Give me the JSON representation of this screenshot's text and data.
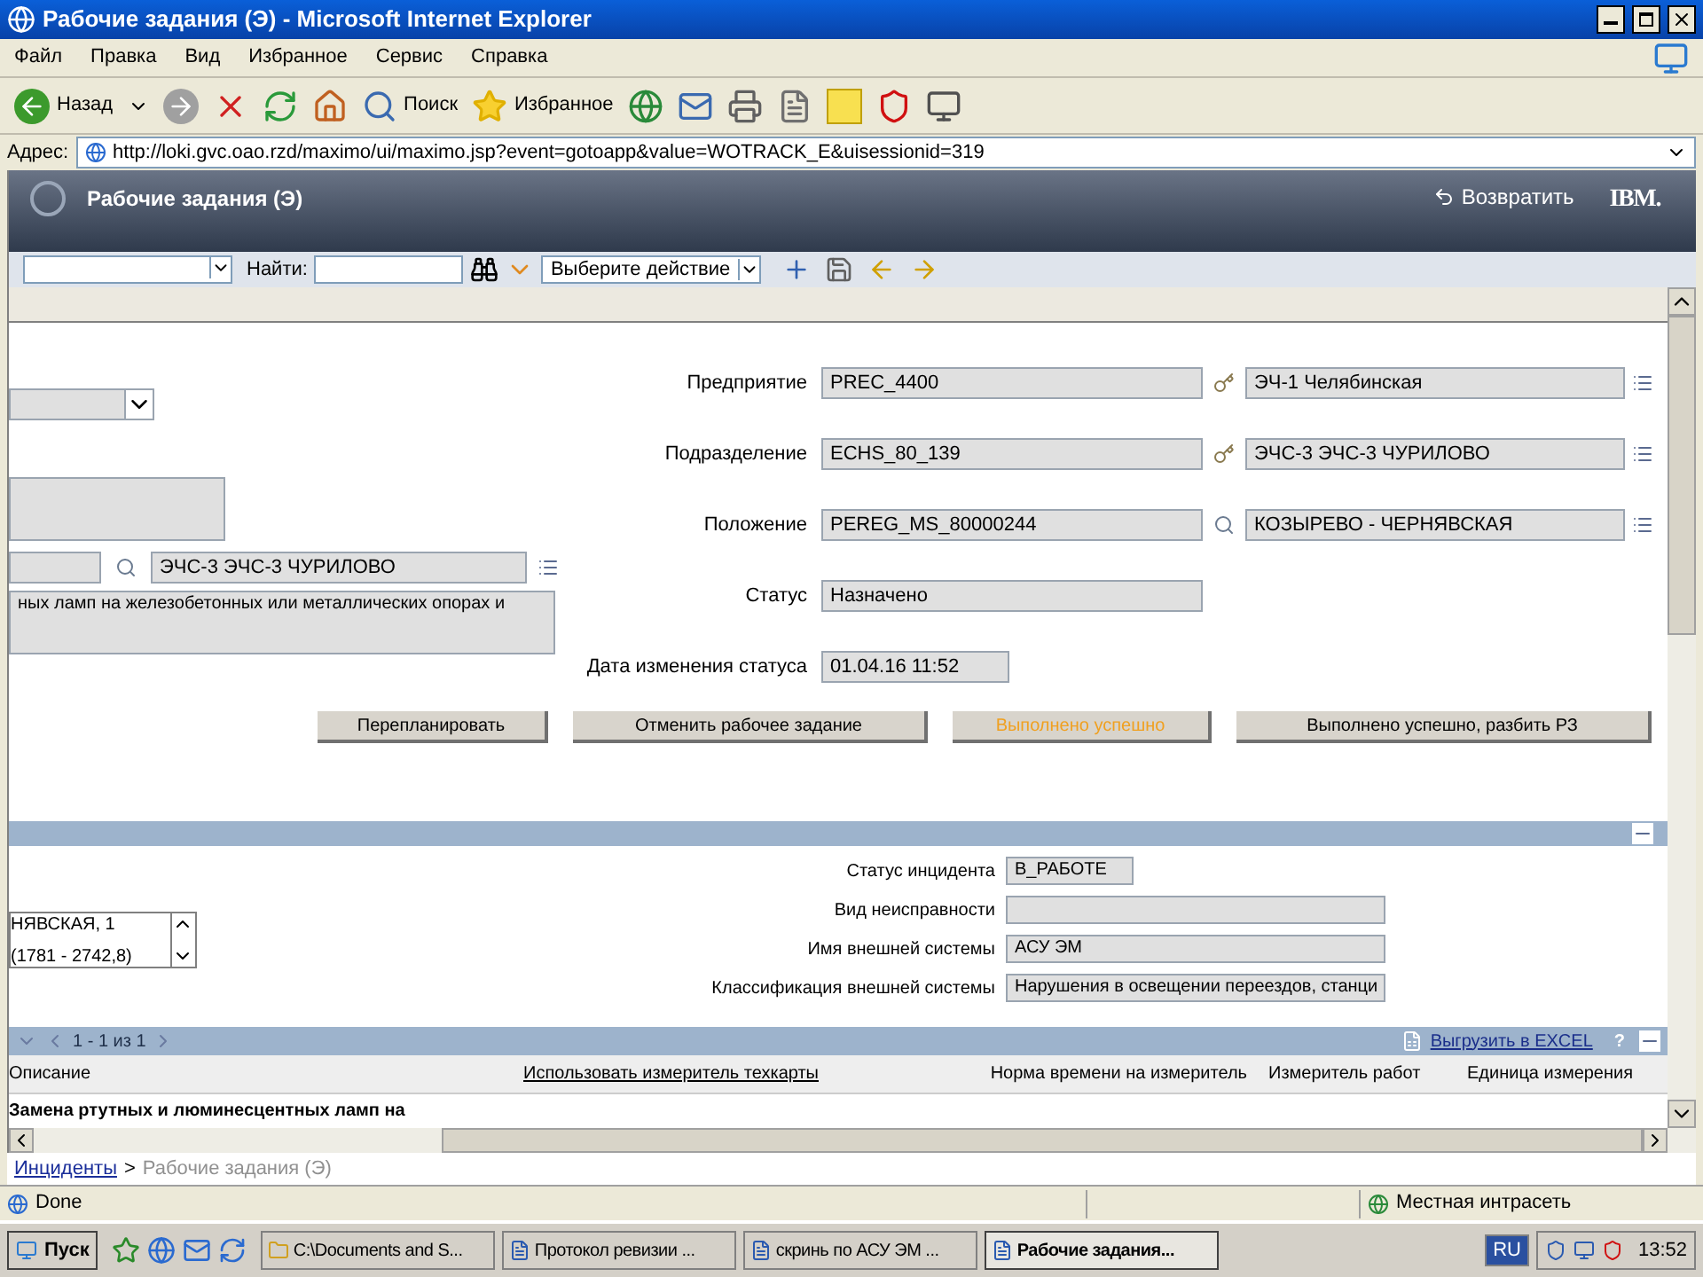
{
  "window": {
    "title": "Рабочие задания (Э) - Microsoft Internet Explorer"
  },
  "menu": [
    "Файл",
    "Правка",
    "Вид",
    "Избранное",
    "Сервис",
    "Справка"
  ],
  "toolbar": {
    "back": "Назад",
    "search": "Поиск",
    "favorites": "Избранное"
  },
  "address": {
    "label": "Адрес:",
    "url": "http://loki.gvc.oao.rzd/maximo/ui/maximo.jsp?event=gotoapp&value=WOTRACK_E&uisessionid=319"
  },
  "app": {
    "title": "Рабочие задания (Э)",
    "back_link": "Возвратить",
    "logo": "IBM."
  },
  "app_toolbar": {
    "find_label": "Найти:",
    "action_select": "Выберите действие"
  },
  "form_left": {
    "lookup_value": "ЭЧС-3 ЭЧС-3 ЧУРИЛОВО",
    "description": "ных ламп на железобетонных или металлических опорах и"
  },
  "form_right": [
    {
      "label": "Предприятие",
      "value": "PREC_4400",
      "kind": "lookup",
      "description": "ЭЧ-1 Челябинская"
    },
    {
      "label": "Подразделение",
      "value": "ECHS_80_139",
      "kind": "lookup",
      "description": "ЭЧС-3 ЭЧС-3 ЧУРИЛОВО"
    },
    {
      "label": "Положение",
      "value": "PEREG_MS_80000244",
      "kind": "lookup",
      "description": "КОЗЫРЕВО - ЧЕРНЯВСКАЯ"
    },
    {
      "label": "Статус",
      "value": "Назначено",
      "kind": "wide"
    },
    {
      "label": "Дата изменения статуса",
      "value": "01.04.16 11:52",
      "kind": "short"
    }
  ],
  "buttons": [
    {
      "label": "Перепланировать",
      "highlighted": false
    },
    {
      "label": "Отменить рабочее задание",
      "highlighted": false
    },
    {
      "label": "Выполнено успешно",
      "highlighted": true
    },
    {
      "label": "Выполнено успешно, разбить РЗ",
      "highlighted": false
    }
  ],
  "incident": {
    "list_lines": [
      "НЯВСКАЯ, 1",
      "(1781 - 2742,8)"
    ],
    "fields": [
      {
        "label": "Статус инцидента",
        "value": "В_РАБОТЕ",
        "kind": "short"
      },
      {
        "label": "Вид неисправности",
        "kind": "wide"
      },
      {
        "label": "Имя внешней системы",
        "value": "АСУ ЭМ",
        "kind": "wide"
      },
      {
        "label": "Классификация внешней системы",
        "value": "Нарушения в освещении переездов, станци",
        "kind": "wide"
      }
    ]
  },
  "table": {
    "pager": "1 - 1 из 1",
    "export": "Выгрузить в EXCEL",
    "help": "?",
    "columns": [
      {
        "label": "Описание",
        "link": false
      },
      {
        "label": "Использовать измеритель техкарты",
        "link": true
      },
      {
        "label": "Норма времени на измеритель",
        "link": false
      },
      {
        "label": "Измеритель работ",
        "link": false
      },
      {
        "label": "Единица измерения",
        "link": false
      }
    ],
    "rows": [
      {
        "description": "Замена ртутных и люминесцентных ламп на"
      }
    ]
  },
  "breadcrumb": [
    {
      "label": "Инциденты",
      "link": true
    },
    {
      "label": "Рабочие задания (Э)",
      "link": false
    }
  ],
  "breadcrumb_separator": ">",
  "status_bar": {
    "text": "Done",
    "zone": "Местная интрасеть"
  },
  "taskbar": {
    "start": "Пуск",
    "tasks": [
      {
        "label": "C:\\Documents and S...",
        "selected": false
      },
      {
        "label": "Протокол ревизии ...",
        "selected": false
      },
      {
        "label": "скринь по АСУ ЭМ ...",
        "selected": false
      },
      {
        "label": "Рабочие задания...",
        "selected": true
      }
    ],
    "lang": "RU",
    "clock": "13:52"
  }
}
